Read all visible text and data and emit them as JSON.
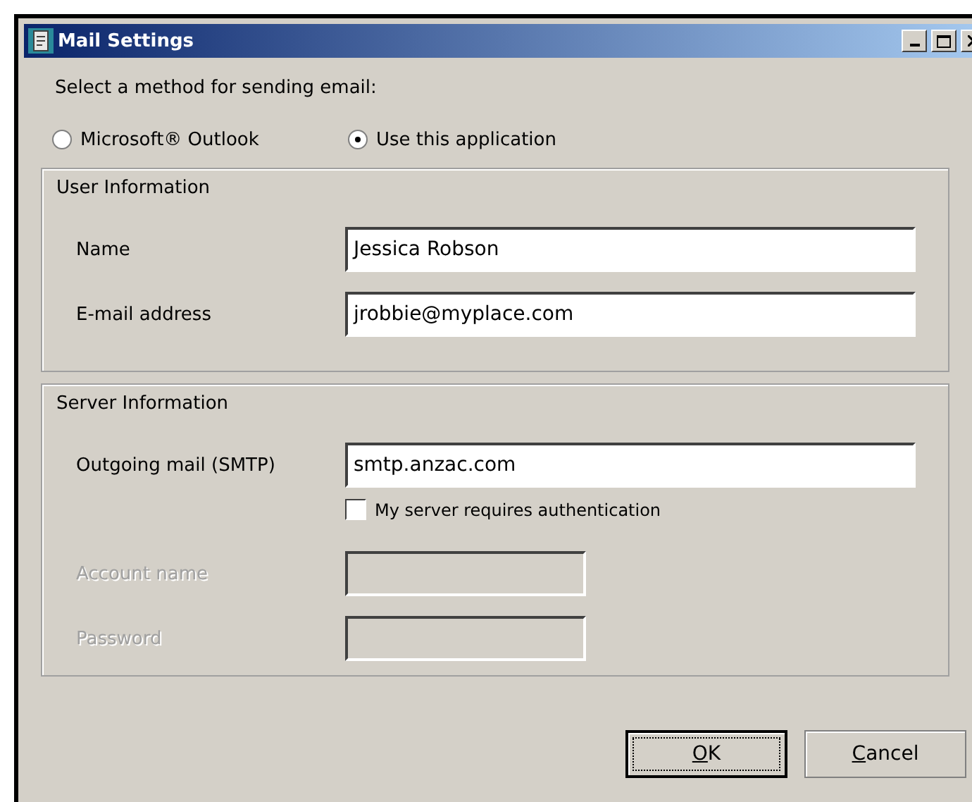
{
  "window": {
    "title": "Mail Settings"
  },
  "prompt": "Select a method for sending email:",
  "methods": [
    {
      "label": "Microsoft® Outlook",
      "selected": false
    },
    {
      "label": "Use this application",
      "selected": true
    }
  ],
  "groups": [
    {
      "title": "User Information",
      "fields": [
        {
          "label": "Name",
          "value": "Jessica Robson",
          "disabled": false
        },
        {
          "label": "E-mail address",
          "value": "jrobbie@myplace.com",
          "disabled": false
        }
      ]
    },
    {
      "title": "Server Information",
      "fields": [
        {
          "label": "Outgoing mail (SMTP)",
          "value": "smtp.anzac.com",
          "disabled": false
        }
      ],
      "checkbox": {
        "label": "My server requires authentication",
        "checked": false
      },
      "auth_fields": [
        {
          "label": "Account name",
          "disabled": true
        },
        {
          "label": "Password",
          "disabled": true
        }
      ]
    }
  ],
  "buttons": [
    {
      "mnemonic": "O",
      "rest": "K",
      "default": true
    },
    {
      "mnemonic": "C",
      "rest": "ancel",
      "default": false
    }
  ]
}
